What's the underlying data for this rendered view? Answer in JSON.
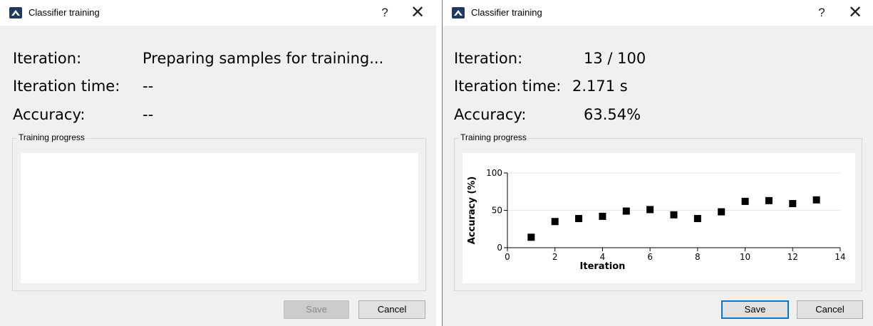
{
  "dialogs": [
    {
      "window_title": "Classifier training",
      "help_label": "?",
      "close_label": "✕",
      "iteration_label": "Iteration:",
      "iteration_value": "Preparing samples for training...",
      "iteration_time_label": "Iteration time:",
      "iteration_time_value": "--",
      "accuracy_label": "Accuracy:",
      "accuracy_value": "--",
      "progress_group_title": "Training progress",
      "save_label": "Save",
      "save_enabled": false,
      "cancel_label": "Cancel"
    },
    {
      "window_title": "Classifier training",
      "help_label": "?",
      "close_label": "✕",
      "iteration_label": "Iteration:",
      "iteration_value": "13 / 100",
      "iteration_time_label": "Iteration time:",
      "iteration_time_value": "2.171 s",
      "accuracy_label": "Accuracy:",
      "accuracy_value": "63.54%",
      "progress_group_title": "Training progress",
      "save_label": "Save",
      "save_enabled": true,
      "cancel_label": "Cancel"
    }
  ],
  "icons": {
    "app": "classifier-app-icon",
    "help": "help-icon",
    "close": "close-icon"
  },
  "colors": {
    "dialog_bg": "#f0f0f0",
    "titlebar_bg": "#ffffff",
    "default_button_border": "#0078d7",
    "marker": "#000000"
  },
  "chart_data": {
    "type": "scatter",
    "xlabel": "Iteration",
    "ylabel": "Accuracy (%)",
    "xlim": [
      0,
      14
    ],
    "ylim": [
      0,
      100
    ],
    "xticks": [
      0,
      2,
      4,
      6,
      8,
      10,
      12,
      14
    ],
    "yticks": [
      0,
      50,
      100
    ],
    "grid": true,
    "x": [
      1,
      2,
      3,
      4,
      5,
      6,
      7,
      8,
      9,
      10,
      11,
      12,
      13
    ],
    "y": [
      14,
      35,
      39,
      42,
      49,
      51,
      44,
      39,
      48,
      62,
      63,
      59,
      64
    ]
  }
}
